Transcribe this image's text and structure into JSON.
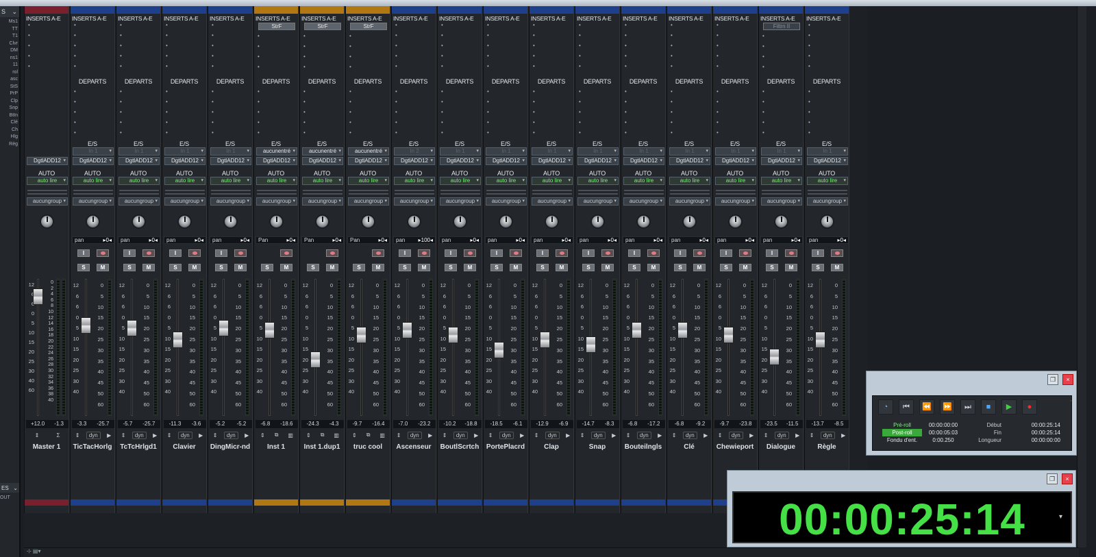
{
  "left_panel": {
    "header": "S",
    "items": [
      "Ms1",
      "TT",
      "T1",
      "Clvr",
      "DM",
      "ns1",
      "11",
      "rol",
      "asc",
      "StS",
      "PrP",
      "Clp",
      "Snp",
      "BtIn",
      "Clé",
      "Ch",
      "Hlg",
      "Règ"
    ],
    "header2": "ES",
    "out_label": "OUT"
  },
  "labels": {
    "inserts": "INSERTS A-E",
    "departs": "DEPARTS",
    "es": "E/S",
    "auto": "AUTO"
  },
  "strips": [
    {
      "name": "Master 1",
      "color": "#7a1f2e",
      "kind": "master",
      "insert": "",
      "es": "",
      "out": "DgtlADD12",
      "auto": "auto lire",
      "group": "aucungroup",
      "pan_label": "",
      "pan_value": "",
      "peak": "+12.0",
      "level": "-1.3",
      "fader": 0.92,
      "sm": false
    },
    {
      "name": "TicTacHorlg",
      "color": "#1d3f8c",
      "kind": "audio",
      "insert": "",
      "es": "In 1",
      "out": "DgtlADD12",
      "auto": "auto lire",
      "group": "aucungroup",
      "pan_label": "pan",
      "pan_value": "0",
      "peak": "-3.3",
      "level": "-25.7",
      "fader": 0.68,
      "sm": true
    },
    {
      "name": "TcTcHrlgd1",
      "color": "#1d3f8c",
      "kind": "audio",
      "insert": "",
      "es": "In 1",
      "out": "DgtlADD12",
      "auto": "auto lire",
      "group": "aucungroup",
      "pan_label": "pan",
      "pan_value": "0",
      "peak": "-5.7",
      "level": "-25.7",
      "fader": 0.66,
      "sm": true
    },
    {
      "name": "Clavier",
      "color": "#1d3f8c",
      "kind": "audio",
      "insert": "",
      "es": "In 1",
      "out": "DgtlADD12",
      "auto": "auto lire",
      "group": "aucungroup",
      "pan_label": "pan",
      "pan_value": "0",
      "peak": "-11.3",
      "level": "-3.6",
      "fader": 0.56,
      "sm": true
    },
    {
      "name": "DingMicr-nd",
      "color": "#1d3f8c",
      "kind": "audio",
      "insert": "",
      "es": "In 1",
      "out": "DgtlADD12",
      "auto": "auto lire",
      "group": "aucungroup",
      "pan_label": "pan",
      "pan_value": "0",
      "peak": "-5.2",
      "level": "-5.2",
      "fader": 0.66,
      "sm": true
    },
    {
      "name": "Inst 1",
      "color": "#b07712",
      "kind": "inst",
      "insert": "StrF",
      "es": "aucunentré",
      "out": "DgtlADD12",
      "auto": "auto lire",
      "group": "aucungroup",
      "pan_label": "Pan",
      "pan_value": "0",
      "peak": "-6.8",
      "level": "-18.6",
      "fader": 0.64,
      "sm": true
    },
    {
      "name": "Inst 1.dup1",
      "color": "#b07712",
      "kind": "inst",
      "insert": "StrF",
      "es": "aucunentré",
      "out": "DgtlADD12",
      "auto": "auto lire",
      "group": "aucungroup",
      "pan_label": "Pan",
      "pan_value": "0",
      "peak": "-24.3",
      "level": "-4.3",
      "fader": 0.4,
      "sm": true
    },
    {
      "name": "truc cool",
      "color": "#b07712",
      "kind": "inst",
      "insert": "StrF",
      "es": "aucunentré",
      "out": "DgtlADD12",
      "auto": "auto lire",
      "group": "aucungroup",
      "pan_label": "Pan",
      "pan_value": "0",
      "peak": "-9.7",
      "level": "-16.4",
      "fader": 0.6,
      "sm": true
    },
    {
      "name": "Ascenseur",
      "color": "#1d3f8c",
      "kind": "audio",
      "insert": "",
      "es": "In 2",
      "out": "DgtlADD12",
      "auto": "auto lire",
      "group": "aucungroup",
      "pan_label": "pan",
      "pan_value": "100",
      "peak": "-7.0",
      "level": "-23.2",
      "fader": 0.64,
      "sm": true
    },
    {
      "name": "BoutlScrtch",
      "color": "#1d3f8c",
      "kind": "audio",
      "insert": "",
      "es": "In 1",
      "out": "DgtlADD12",
      "auto": "auto lire",
      "group": "aucungroup",
      "pan_label": "pan",
      "pan_value": "0",
      "peak": "-10.2",
      "level": "-18.8",
      "fader": 0.6,
      "sm": true
    },
    {
      "name": "PortePlacrd",
      "color": "#1d3f8c",
      "kind": "audio",
      "insert": "",
      "es": "In 1",
      "out": "DgtlADD12",
      "auto": "auto lire",
      "group": "aucungroup",
      "pan_label": "pan",
      "pan_value": "0",
      "peak": "-18.5",
      "level": "-6.1",
      "fader": 0.48,
      "sm": true
    },
    {
      "name": "Clap",
      "color": "#1d3f8c",
      "kind": "audio",
      "insert": "",
      "es": "In 1",
      "out": "DgtlADD12",
      "auto": "auto lire",
      "group": "aucungroup",
      "pan_label": "pan",
      "pan_value": "0",
      "peak": "-12.9",
      "level": "-6.9",
      "fader": 0.56,
      "sm": true
    },
    {
      "name": "Snap",
      "color": "#1d3f8c",
      "kind": "audio",
      "insert": "",
      "es": "In 1",
      "out": "DgtlADD12",
      "auto": "auto lire",
      "group": "aucungroup",
      "pan_label": "pan",
      "pan_value": "0",
      "peak": "-14.7",
      "level": "-8.3",
      "fader": 0.52,
      "sm": true
    },
    {
      "name": "Bouteilngls",
      "color": "#1d3f8c",
      "kind": "audio",
      "insert": "",
      "es": "In 1",
      "out": "DgtlADD12",
      "auto": "auto lire",
      "group": "aucungroup",
      "pan_label": "pan",
      "pan_value": "0",
      "peak": "-6.8",
      "level": "-17.2",
      "fader": 0.64,
      "sm": true
    },
    {
      "name": "Clé",
      "color": "#1d3f8c",
      "kind": "audio",
      "insert": "",
      "es": "In 1",
      "out": "DgtlADD12",
      "auto": "auto lire",
      "group": "aucungroup",
      "pan_label": "pan",
      "pan_value": "0",
      "peak": "-6.8",
      "level": "-9.2",
      "fader": 0.64,
      "sm": true
    },
    {
      "name": "Chewieport",
      "color": "#1d3f8c",
      "kind": "audio",
      "insert": "",
      "es": "In 1",
      "out": "DgtlADD12",
      "auto": "auto lire",
      "group": "aucungroup",
      "pan_label": "pan",
      "pan_value": "0",
      "peak": "-9.7",
      "level": "-23.8",
      "fader": 0.6,
      "sm": true
    },
    {
      "name": "Dialogue",
      "color": "#1d3f8c",
      "kind": "audio",
      "insert": "Filtrn II",
      "es": "In 1",
      "out": "DgtlADD12",
      "auto": "auto lire",
      "group": "aucungroup",
      "pan_label": "pan",
      "pan_value": "0",
      "peak": "-23.5",
      "level": "-11.5",
      "fader": 0.42,
      "sm": true
    },
    {
      "name": "Règle",
      "color": "#1d3f8c",
      "kind": "audio",
      "insert": "",
      "es": "In 1",
      "out": "DgtlADD12",
      "auto": "auto lire",
      "group": "aucungroup",
      "pan_label": "pan",
      "pan_value": "0",
      "peak": "-13.7",
      "level": "-8.5",
      "fader": 0.56,
      "sm": true
    }
  ],
  "scale_left": [
    "12",
    "6",
    "6",
    "0",
    "5",
    "10",
    "15",
    "20",
    "25",
    "30",
    "40",
    "60"
  ],
  "scale_right": [
    "0",
    "5",
    "10",
    "15",
    "20",
    "25",
    "30",
    "35",
    "40",
    "45",
    "50",
    "60"
  ],
  "master_scale": [
    "0",
    "2",
    "4",
    "6",
    "8",
    "10",
    "12",
    "14",
    "16",
    "18",
    "20",
    "22",
    "24",
    "26",
    "28",
    "30",
    "32",
    "34",
    "36",
    "38",
    "40"
  ],
  "btn": {
    "input": "I",
    "solo": "S",
    "mute": "M",
    "dyn": "dyn"
  },
  "transport": {
    "rows": [
      {
        "a": "Pré-roll",
        "b": "00:00:00:00",
        "c": "Début",
        "d": "00:00:25:14"
      },
      {
        "a": "Post-roll",
        "b": "00:00:05:03",
        "c": "Fin",
        "d": "00:00:25:14"
      },
      {
        "a": "Fondu d'ent.",
        "b": "0:00.250",
        "c": "Longueur",
        "d": "00:00:00:00"
      }
    ]
  },
  "clock": {
    "time": "00:00:25:14"
  }
}
